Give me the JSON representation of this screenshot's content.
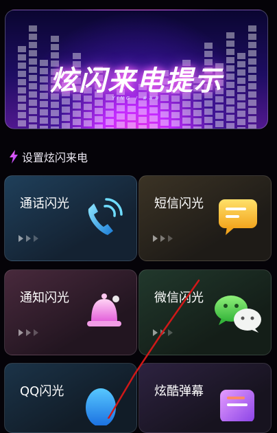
{
  "banner": {
    "title": "炫闪来电提示",
    "subtitle": "YING / ###"
  },
  "section": {
    "title": "设置炫闪来电",
    "icon": "lightning-icon"
  },
  "cards": [
    {
      "label": "通话闪光",
      "icon": "phone-call-icon"
    },
    {
      "label": "短信闪光",
      "icon": "message-icon"
    },
    {
      "label": "通知闪光",
      "icon": "bell-icon"
    },
    {
      "label": "微信闪光",
      "icon": "wechat-icon"
    },
    {
      "label": "QQ闪光",
      "icon": "qq-penguin-icon"
    },
    {
      "label": "炫酷弹幕",
      "icon": "barrage-icon"
    }
  ],
  "colors": {
    "accent_pink": "#ff3bd4",
    "accent_purple": "#b54cff",
    "annotation_red": "#d01818"
  }
}
